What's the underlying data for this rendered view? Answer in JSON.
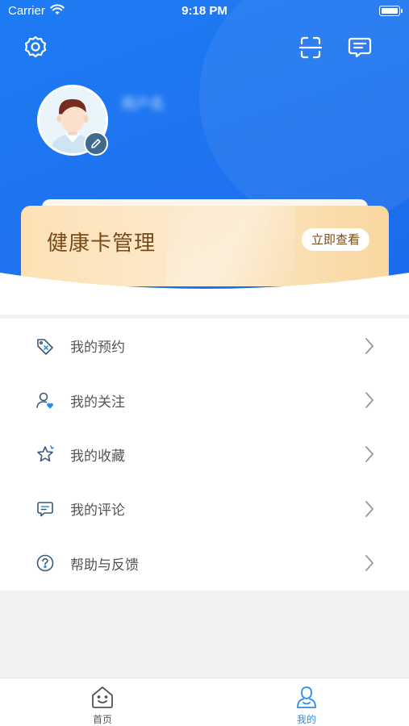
{
  "status_bar": {
    "carrier": "Carrier",
    "time": "9:18 PM"
  },
  "header": {
    "username": "用户名"
  },
  "health_card": {
    "title": "健康卡管理",
    "button_label": "立即查看"
  },
  "menu": {
    "items": [
      {
        "label": "我的预约",
        "icon": "appointment-tag-icon"
      },
      {
        "label": "我的关注",
        "icon": "follow-user-icon"
      },
      {
        "label": "我的收藏",
        "icon": "star-icon"
      },
      {
        "label": "我的评论",
        "icon": "comment-icon"
      },
      {
        "label": "帮助与反馈",
        "icon": "help-icon"
      }
    ]
  },
  "tabbar": {
    "tabs": [
      {
        "label": "首页",
        "icon": "home-icon",
        "active": false
      },
      {
        "label": "我的",
        "icon": "profile-icon",
        "active": true
      }
    ]
  },
  "colors": {
    "primary": "#1e7cf3",
    "card_text": "#7a4a1c",
    "active_tab": "#2b8cf4",
    "inactive_tab": "#555555"
  }
}
